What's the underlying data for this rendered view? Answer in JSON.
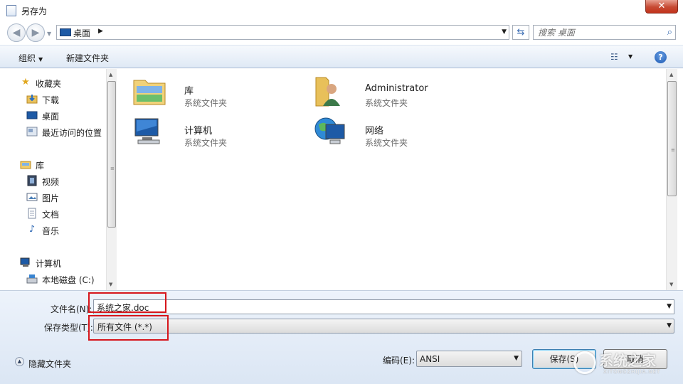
{
  "window": {
    "title": "另存为",
    "close_label": "✕"
  },
  "address": {
    "location": "桌面",
    "search_placeholder": "搜索 桌面"
  },
  "toolbar": {
    "organize": "组织",
    "new_folder": "新建文件夹",
    "help": "?"
  },
  "nav_pane": {
    "items": [
      {
        "label": "收藏夹",
        "icon": "favorites-star-icon"
      },
      {
        "label": "下载",
        "icon": "downloads-folder-icon"
      },
      {
        "label": "桌面",
        "icon": "desktop-icon"
      },
      {
        "label": "最近访问的位置",
        "icon": "recent-places-icon"
      },
      {
        "label": "库",
        "icon": "libraries-icon"
      },
      {
        "label": "视频",
        "icon": "videos-icon"
      },
      {
        "label": "图片",
        "icon": "pictures-icon"
      },
      {
        "label": "文档",
        "icon": "documents-icon"
      },
      {
        "label": "音乐",
        "icon": "music-icon"
      },
      {
        "label": "计算机",
        "icon": "computer-icon"
      },
      {
        "label": "本地磁盘 (C:)",
        "icon": "local-disk-icon"
      }
    ]
  },
  "content": {
    "items": [
      {
        "name": "库",
        "type": "系统文件夹",
        "icon": "libraries-folder-icon"
      },
      {
        "name": "Administrator",
        "type": "系统文件夹",
        "icon": "user-folder-icon"
      },
      {
        "name": "计算机",
        "type": "系统文件夹",
        "icon": "computer-icon"
      },
      {
        "name": "网络",
        "type": "系统文件夹",
        "icon": "network-icon"
      }
    ]
  },
  "save_form": {
    "filename_label": "文件名(N):",
    "filename_value": "系统之家.doc",
    "filetype_label": "保存类型(T):",
    "filetype_value": "所有文件 (*.*)",
    "hide_folders": "隐藏文件夹",
    "encoding_label": "编码(E):",
    "encoding_value": "ANSI",
    "save_button": "保存(S)",
    "cancel_button": "取消"
  },
  "colors": {
    "highlight": "#d6161c",
    "toolbar_bg": "#dfe9f5",
    "close": "#c74a33"
  },
  "watermark": {
    "text": "系统之家",
    "subtext": "XITONGZHIJIA.NET"
  }
}
